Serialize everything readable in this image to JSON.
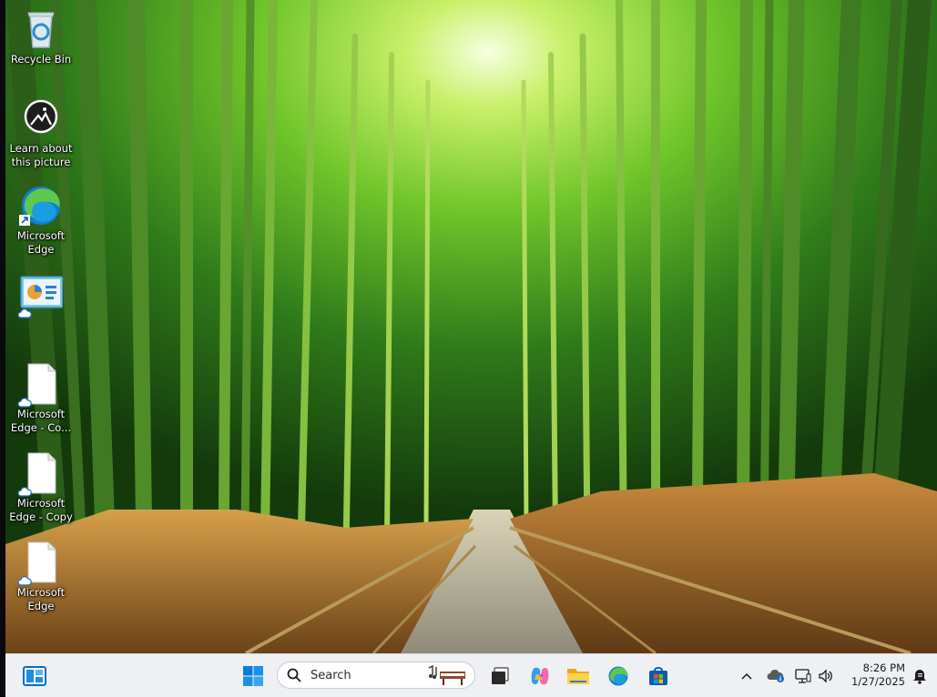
{
  "desktop": {
    "icons": [
      {
        "label": "Recycle Bin",
        "icon": "recycle-bin-icon"
      },
      {
        "label": "Learn about this picture",
        "icon": "learn-picture-icon"
      },
      {
        "label": "Microsoft Edge",
        "icon": "edge-icon"
      },
      {
        "label": "",
        "icon": "presentation-file-icon"
      },
      {
        "label": "Microsoft Edge - Co...",
        "icon": "blank-file-icon"
      },
      {
        "label": "Microsoft Edge - Copy",
        "icon": "blank-file-icon"
      },
      {
        "label": "Microsoft Edge",
        "icon": "blank-file-icon"
      }
    ]
  },
  "taskbar": {
    "search": {
      "placeholder": "Search"
    },
    "pinned": [
      "widgets-icon",
      "windows-start-icon",
      "task-view-icon",
      "copilot-icon",
      "file-explorer-icon",
      "edge-icon",
      "microsoft-store-icon"
    ],
    "clock": {
      "time": "8:26 PM",
      "date": "1/27/2025"
    },
    "tray": [
      "chevron-up-icon",
      "onedrive-icon",
      "network-icon",
      "volume-icon",
      "notification-icon"
    ]
  },
  "colors": {
    "taskbar_bg": "#eef0f4",
    "edge_blue": "#0f7fd6",
    "edge_green": "#5fc94f",
    "windows_blue": "#0a7cd4"
  }
}
